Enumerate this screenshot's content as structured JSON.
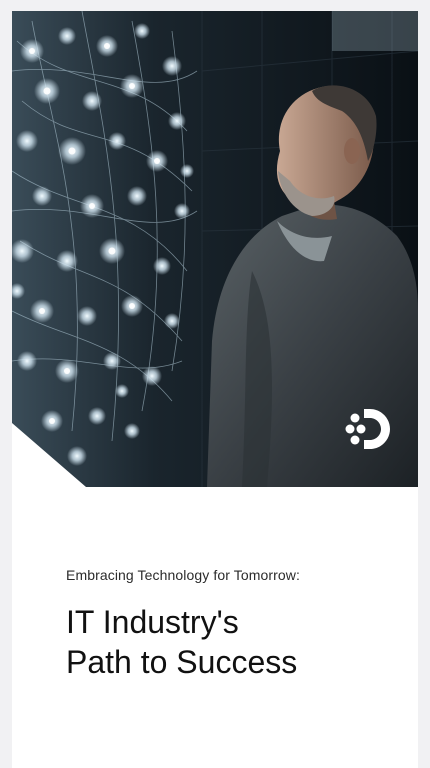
{
  "hero": {
    "image_description_icon": "man-looking-at-network-visualization-image",
    "logo_icon": "brand-logo-icon"
  },
  "content": {
    "subtitle": "Embracing Technology for Tomorrow:",
    "title_line_1": "IT Industry's",
    "title_line_2": "Path to Success"
  },
  "colors": {
    "background": "#f1f1f3",
    "card": "#ffffff",
    "hero_dark": "#0d141a",
    "glow": "#cfe3ef",
    "text": "#111111"
  }
}
